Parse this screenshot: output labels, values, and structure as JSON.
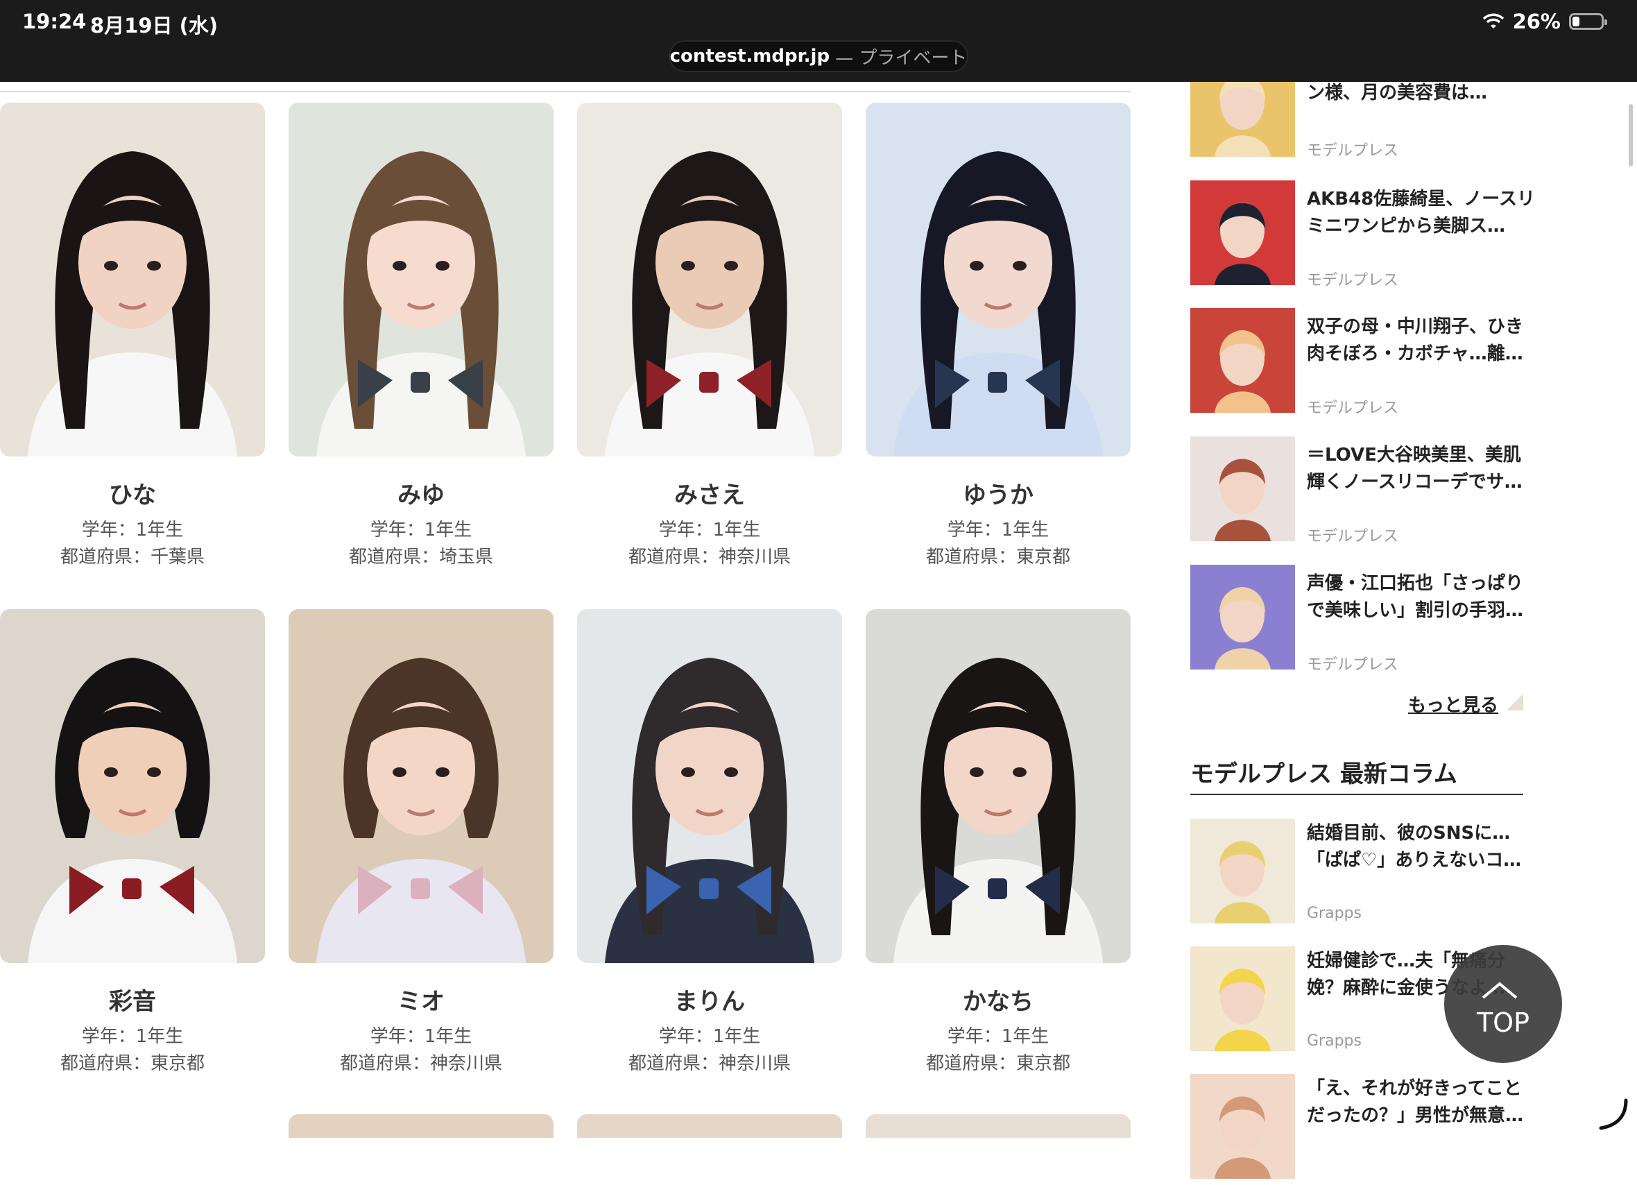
{
  "status": {
    "time": "19:24",
    "date": "8月19日 (水)",
    "battery": "26%"
  },
  "browser": {
    "domain": "contest.mdpr.jp",
    "separator": " — ",
    "mode": "プライベート"
  },
  "contestants": [
    {
      "name": "ひな",
      "grade": "学年：1年生",
      "pref": "都道府県：千葉県"
    },
    {
      "name": "みゆ",
      "grade": "学年：1年生",
      "pref": "都道府県：埼玉県"
    },
    {
      "name": "みさえ",
      "grade": "学年：1年生",
      "pref": "都道府県：神奈川県"
    },
    {
      "name": "ゆうか",
      "grade": "学年：1年生",
      "pref": "都道府県：東京都"
    },
    {
      "name": "彩音",
      "grade": "学年：1年生",
      "pref": "都道府県：東京都"
    },
    {
      "name": "ミオ",
      "grade": "学年：1年生",
      "pref": "都道府県：神奈川県"
    },
    {
      "name": "まりん",
      "grade": "学年：1年生",
      "pref": "都道府県：神奈川県"
    },
    {
      "name": "かなち",
      "grade": "学年：1年生",
      "pref": "都道府県：東京都"
    }
  ],
  "sidebar": {
    "news": [
      {
        "title": "ン様、月の美容費は…",
        "source": "モデルプレス"
      },
      {
        "title": "AKB48佐藤綺星、ノースリミニワンピから美脚ス…",
        "source": "モデルプレス"
      },
      {
        "title": "双子の母・中川翔子、ひき肉そぼろ・カボチャ…離…",
        "source": "モデルプレス"
      },
      {
        "title": "＝LOVE大谷映美里、美肌輝くノースリコーデでサ…",
        "source": "モデルプレス"
      },
      {
        "title": "声優・江口拓也「さっぱりで美味しい」割引の手羽…",
        "source": "モデルプレス"
      }
    ],
    "more_label": "もっと見る",
    "column_heading": "モデルプレス 最新コラム",
    "columns": [
      {
        "title": "結婚目前、彼のSNSに…「ぱぱ♡」ありえないコ…",
        "source": "Grapps"
      },
      {
        "title": "妊婦健診で…夫「無痛分娩？麻酔に金使うなよ…",
        "source": "Grapps"
      },
      {
        "title": "「え、それが好きってことだったの？」男性が無意…",
        "source": ""
      }
    ]
  },
  "top_button": {
    "label": "TOP"
  }
}
